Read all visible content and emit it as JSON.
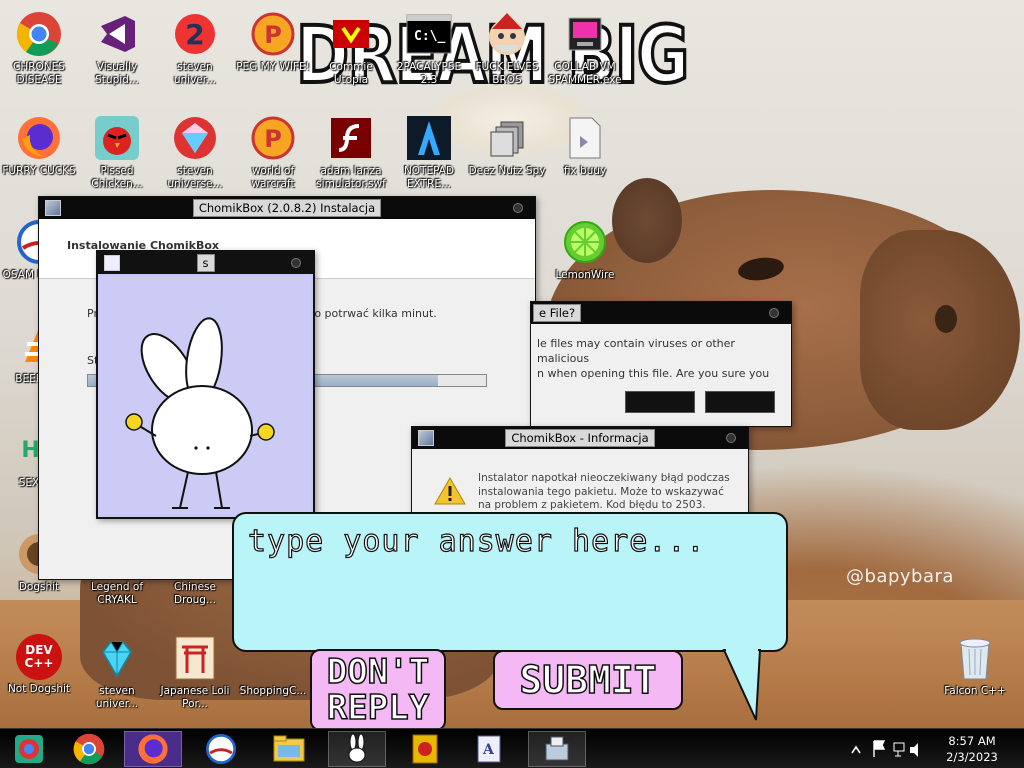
{
  "wallpaper": {
    "top_caption": "DREAM BIG",
    "watermark": "@bapybara"
  },
  "desktop_icons": [
    {
      "label": "CHRONES DISEASE",
      "icon": "chrome-icon"
    },
    {
      "label": "Visually Stupid...",
      "icon": "visual-studio-icon"
    },
    {
      "label": "steven univer...",
      "icon": "steven-universe-2-icon"
    },
    {
      "label": "PEG MY WIFE!",
      "icon": "peggle-icon"
    },
    {
      "label": "Commie Utopia",
      "icon": "commie-icon"
    },
    {
      "label": "2PACALYPSE 2.3",
      "icon": "cmd-icon"
    },
    {
      "label": "FUCK ELVES BROS",
      "icon": "elf-icon"
    },
    {
      "label": "COLLAB VM SPAMMER.exe",
      "icon": "spammer-icon"
    },
    {
      "label": "FURRY CUCKS",
      "icon": "firefox-icon"
    },
    {
      "label": "Pissed Chicken...",
      "icon": "angry-birds-icon"
    },
    {
      "label": "steven universe...",
      "icon": "gem-icon"
    },
    {
      "label": "world of warcraft",
      "icon": "peggle-icon"
    },
    {
      "label": "adam lanza simulator.swf",
      "icon": "flash-icon"
    },
    {
      "label": "NOTEPAD EXTRE...",
      "icon": "notepad-extreme-icon"
    },
    {
      "label": "Deez Nutz Spy",
      "icon": "copy-icon"
    },
    {
      "label": "fix buuy",
      "icon": "file-icon"
    },
    {
      "label": "OSAM LADE...",
      "icon": "obama-icon"
    },
    {
      "label": "LemonWire",
      "icon": "limewire-icon"
    },
    {
      "label": "BEEP C...",
      "icon": "vlc-icon"
    },
    {
      "label": "SEX E...",
      "icon": "hx-icon"
    },
    {
      "label": "Dogshit",
      "icon": "dogshit-icon"
    },
    {
      "label": "Legend of CRYAKL",
      "icon": "legend-icon"
    },
    {
      "label": "Chinese Droug...",
      "icon": "chinese-icon"
    },
    {
      "label": "Not Dogshit",
      "icon": "dev-cpp-icon"
    },
    {
      "label": "steven univer...",
      "icon": "diamond-icon"
    },
    {
      "label": "Japanese Loli Por...",
      "icon": "torii-icon"
    },
    {
      "label": "ShoppingC...",
      "icon": "shopping-icon"
    },
    {
      "label": "Falcon C++",
      "icon": "recycle-bin-icon"
    }
  ],
  "devcpp_glyph": "DEV C++",
  "hx_glyph": "HX",
  "installer": {
    "title": "ChomikBox (2.0.8.2) Instalacja",
    "header": "Instalowanie ChomikBox",
    "status_text": "Pr... może to potrwać kilka minut.",
    "status_prefix": "Pr",
    "status_suffix": "że to potrwać kilka minut.",
    "status_label": "St",
    "progress_percent": 88
  },
  "bunny_window": {
    "title": "s"
  },
  "warning_dialog": {
    "title": "e File?",
    "body_line1": "le files may contain viruses or other malicious",
    "body_line2": "n when opening this file. Are you sure you"
  },
  "info_dialog": {
    "title": "ChomikBox - Informacja",
    "message": "Instalator napotkał nieoczekiwany błąd podczas instalowania tego pakietu. Może to wskazywać na problem z pakietem. Kod błędu to 2503."
  },
  "prompt": {
    "placeholder": "type your answer here...",
    "dont_reply_label": "DON'T REPLY",
    "submit_label": "SUBMIT"
  },
  "taskbar": {
    "items": [
      "chrome-alt-icon",
      "chrome-icon",
      "firefox-icon",
      "obama-icon",
      "explorer-icon",
      "bunny-icon",
      "torii-book-icon",
      "wordpad-icon",
      "installer-icon"
    ],
    "active_index": 8
  },
  "clock": {
    "time": "8:57 AM",
    "date": "2/3/2023"
  },
  "colors": {
    "bubble": "#b8f4f8",
    "pill": "#f4b8f4",
    "bunny_bg": "#cbcbf6",
    "taskbar": "#000000"
  }
}
